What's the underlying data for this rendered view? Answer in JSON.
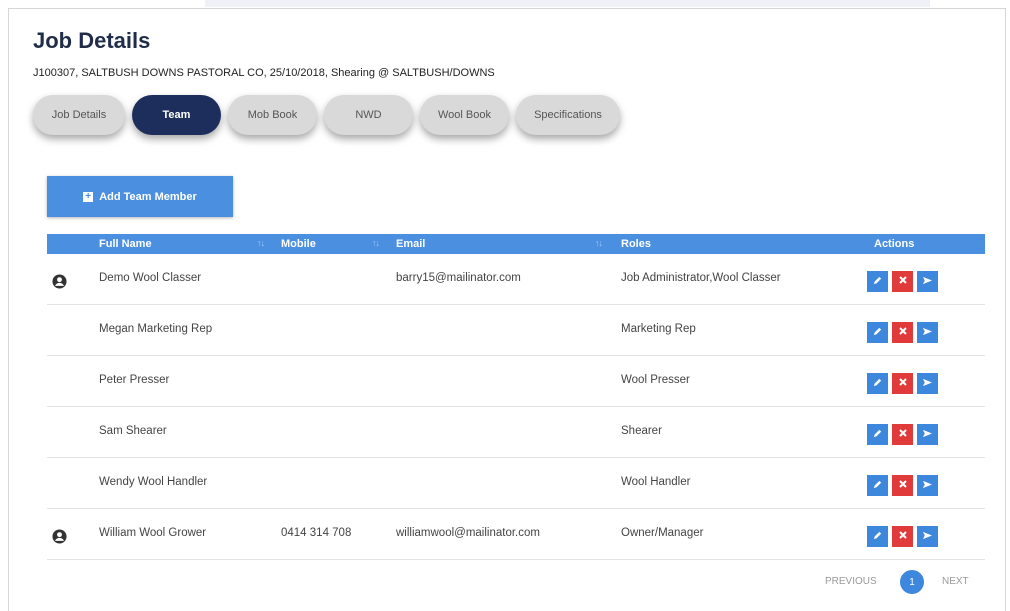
{
  "page": {
    "title": "Job Details",
    "subtitle": "J100307, SALTBUSH DOWNS PASTORAL CO, 25/10/2018, Shearing @ SALTBUSH/DOWNS"
  },
  "tabs": [
    {
      "label": "Job Details",
      "active": false
    },
    {
      "label": "Team",
      "active": true
    },
    {
      "label": "Mob Book",
      "active": false
    },
    {
      "label": "NWD",
      "active": false
    },
    {
      "label": "Wool Book",
      "active": false
    },
    {
      "label": "Specifications",
      "active": false
    }
  ],
  "add_button": {
    "label": "Add Team Member"
  },
  "table": {
    "headers": {
      "full_name": "Full Name",
      "mobile": "Mobile",
      "email": "Email",
      "roles": "Roles",
      "actions": "Actions"
    },
    "rows": [
      {
        "full_name": "Demo Wool Classer",
        "mobile": "",
        "email": "barry15@mailinator.com",
        "roles": "Job Administrator,Wool Classer",
        "has_user_icon": true
      },
      {
        "full_name": "Megan Marketing Rep",
        "mobile": "",
        "email": "",
        "roles": "Marketing Rep",
        "has_user_icon": false
      },
      {
        "full_name": "Peter Presser",
        "mobile": "",
        "email": "",
        "roles": "Wool Presser",
        "has_user_icon": false
      },
      {
        "full_name": "Sam Shearer",
        "mobile": "",
        "email": "",
        "roles": "Shearer",
        "has_user_icon": false
      },
      {
        "full_name": "Wendy Wool Handler",
        "mobile": "",
        "email": "",
        "roles": "Wool Handler",
        "has_user_icon": false
      },
      {
        "full_name": "William Wool Grower",
        "mobile": "0414 314 708",
        "email": "williamwool@mailinator.com",
        "roles": "Owner/Manager",
        "has_user_icon": true
      }
    ]
  },
  "pagination": {
    "previous": "PREVIOUS",
    "current_page": "1",
    "next": "NEXT"
  },
  "colors": {
    "primary": "#4a8fe0",
    "active_tab": "#1e2e5c",
    "delete": "#e03a3a",
    "title": "#1f2d4a"
  },
  "icons": {
    "user": "user-circle-icon",
    "edit": "pencil-icon",
    "delete": "close-icon",
    "send": "send-icon",
    "add": "plus-square-icon"
  }
}
